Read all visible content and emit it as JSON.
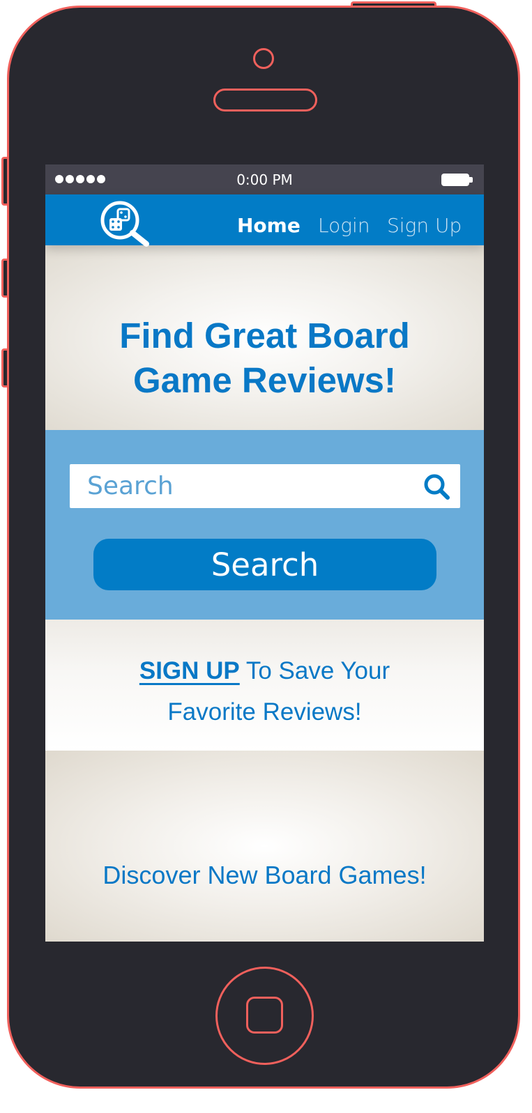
{
  "status_bar": {
    "time": "0:00 PM",
    "signal_icon": "signal-dots-icon",
    "battery_icon": "battery-icon"
  },
  "nav": {
    "logo_icon": "dice-magnifier-logo-icon",
    "items": [
      {
        "label": "Home",
        "active": true
      },
      {
        "label": "Login",
        "active": false
      },
      {
        "label": "Sign Up",
        "active": false
      }
    ]
  },
  "hero": {
    "title": "Find Great Board\nGame Reviews!"
  },
  "search": {
    "placeholder": "Search",
    "icon": "search-icon",
    "button_label": "Search"
  },
  "promo": {
    "signup_link": "SIGN UP",
    "line1_rest": " To Save Your",
    "line2": "Favorite Reviews!"
  },
  "discover": {
    "label": "Discover New Board Games!"
  },
  "colors": {
    "phone_body": "#28282f",
    "phone_outline": "#f0605c",
    "status_bar": "#45444f",
    "nav_blue": "#027cc6",
    "search_band": "#69acda",
    "text_blue": "#0978c6"
  }
}
